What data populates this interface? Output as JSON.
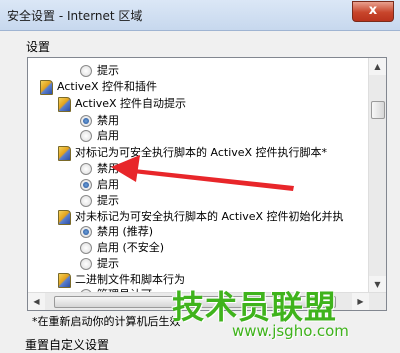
{
  "window": {
    "title": "安全设置 - Internet 区域",
    "close_glyph": "x"
  },
  "group_label": "设置",
  "settings_tree": {
    "rows": [
      {
        "kind": "radio",
        "label": "提示",
        "checked": false
      },
      {
        "kind": "category",
        "label": "ActiveX 控件和插件"
      },
      {
        "kind": "setting",
        "label": "ActiveX 控件自动提示"
      },
      {
        "kind": "radio",
        "label": "禁用",
        "checked": true
      },
      {
        "kind": "radio",
        "label": "启用",
        "checked": false
      },
      {
        "kind": "setting",
        "label": "对标记为可安全执行脚本的 ActiveX 控件执行脚本*"
      },
      {
        "kind": "radio",
        "label": "禁用",
        "checked": false
      },
      {
        "kind": "radio",
        "label": "启用",
        "checked": true
      },
      {
        "kind": "radio",
        "label": "提示",
        "checked": false
      },
      {
        "kind": "setting",
        "label": "对未标记为可安全执行脚本的 ActiveX 控件初始化并执"
      },
      {
        "kind": "radio",
        "label": "禁用 (推荐)",
        "checked": true
      },
      {
        "kind": "radio",
        "label": "启用 (不安全)",
        "checked": false
      },
      {
        "kind": "radio",
        "label": "提示",
        "checked": false
      },
      {
        "kind": "setting",
        "label": "二进制文件和脚本行为"
      },
      {
        "kind": "radio",
        "label": "管理员认可",
        "checked": false
      }
    ]
  },
  "scrollbar": {
    "up": "▲",
    "down": "▼",
    "left": "◀",
    "right": "▶"
  },
  "footer_note": "*在重新启动你的计算机后生效",
  "reset_section_label": "重置自定义设置",
  "watermark": {
    "logo_text": "技术员联盟",
    "url": "www.jsgho.com"
  },
  "colors": {
    "annotation_arrow": "#e8262a",
    "watermark": "#3fb31c"
  }
}
